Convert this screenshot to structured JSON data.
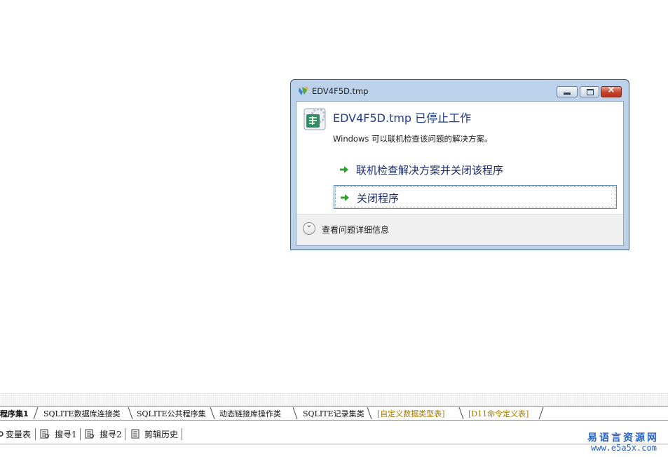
{
  "dialog": {
    "title": "EDV4F5D.tmp",
    "heading": "EDV4F5D.tmp 已停止工作",
    "subtext": "Windows 可以联机检查该问题的解决方案。",
    "options": [
      {
        "label": "联机检查解决方案并关闭该程序",
        "icon": "green-arrow-icon"
      },
      {
        "label": "关闭程序",
        "icon": "green-arrow-icon"
      }
    ],
    "details_label": "查看问题详细信息",
    "caption_close": "×"
  },
  "ide": {
    "tabs": [
      {
        "label": "程序集1"
      },
      {
        "label": "SQLITE数据库连接类"
      },
      {
        "label": "SQLITE公共程序集"
      },
      {
        "label": "动态链接库操作类"
      },
      {
        "label": "SQLITE记录集类"
      },
      {
        "label": "[自定义数据类型表]"
      },
      {
        "label": "[D11命令定义表]"
      }
    ],
    "panels": [
      {
        "label": "变量表"
      },
      {
        "label": "搜寻1"
      },
      {
        "label": "搜寻2"
      },
      {
        "label": "剪辑历史"
      }
    ]
  },
  "watermark": {
    "name": "易语言资源网",
    "url": "www.e5a5x.com"
  },
  "colors": {
    "heading": "#1e3d8f",
    "arrow": "#2ea02e",
    "close_button": "#c5432b",
    "watermark": "#2a63c8",
    "tab_gold": "#a57a00"
  }
}
